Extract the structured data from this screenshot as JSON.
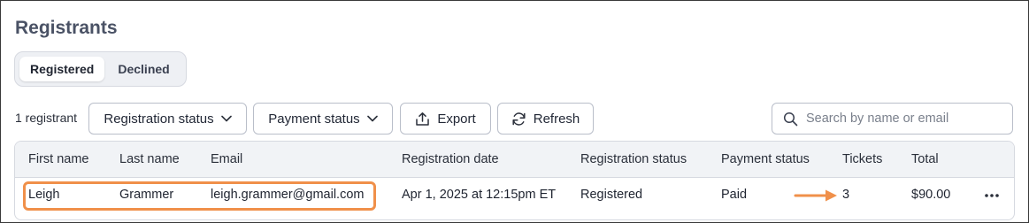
{
  "page": {
    "title": "Registrants"
  },
  "tabs": [
    {
      "label": "Registered",
      "active": true
    },
    {
      "label": "Declined",
      "active": false
    }
  ],
  "toolbar": {
    "count": "1 registrant",
    "registration_status_label": "Registration status",
    "payment_status_label": "Payment status",
    "export_label": "Export",
    "refresh_label": "Refresh",
    "search_placeholder": "Search by name or email",
    "search_value": ""
  },
  "table": {
    "columns": [
      "First name",
      "Last name",
      "Email",
      "Registration date",
      "Registration status",
      "Payment status",
      "Tickets",
      "Total"
    ],
    "rows": [
      {
        "first_name": "Leigh",
        "last_name": "Grammer",
        "email": "leigh.grammer@gmail.com",
        "registration_date": "Apr 1, 2025 at 12:15pm ET",
        "registration_status": "Registered",
        "payment_status": "Paid",
        "tickets": "3",
        "total": "$90.00",
        "more": "•••"
      }
    ]
  },
  "colors": {
    "highlight": "#f0904a",
    "header_bg": "#f1f3f6",
    "title": "#4a5265"
  },
  "icons": {
    "dropdown": "chevron-down-icon",
    "export": "export-icon",
    "refresh": "refresh-icon",
    "search": "search-icon",
    "more": "more-horizontal-icon",
    "annotation": "arrow-right-icon"
  }
}
